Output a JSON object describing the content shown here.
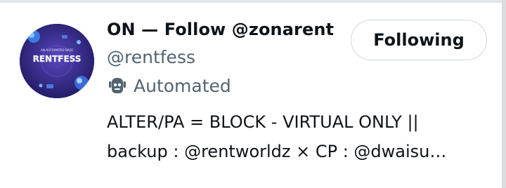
{
  "profile": {
    "display_name": "ON — Follow @zonarent",
    "handle": "@rentfess",
    "automated_label": "Automated",
    "bio_lines": [
      "ALTER/PA = BLOCK - VIRTUAL ONLY ||",
      "backup : @rentworldz × CP : @dwaisu…"
    ],
    "avatar": {
      "text_main": "RENTFESS",
      "text_top": "AN AUTOMATED BASE",
      "icon": "avatar-image"
    }
  },
  "follow_button": {
    "label": "Following"
  },
  "colors": {
    "text_primary": "#0f1419",
    "text_secondary": "#536471",
    "border": "#cfd9de",
    "avatar_bg": "#2f2580"
  }
}
